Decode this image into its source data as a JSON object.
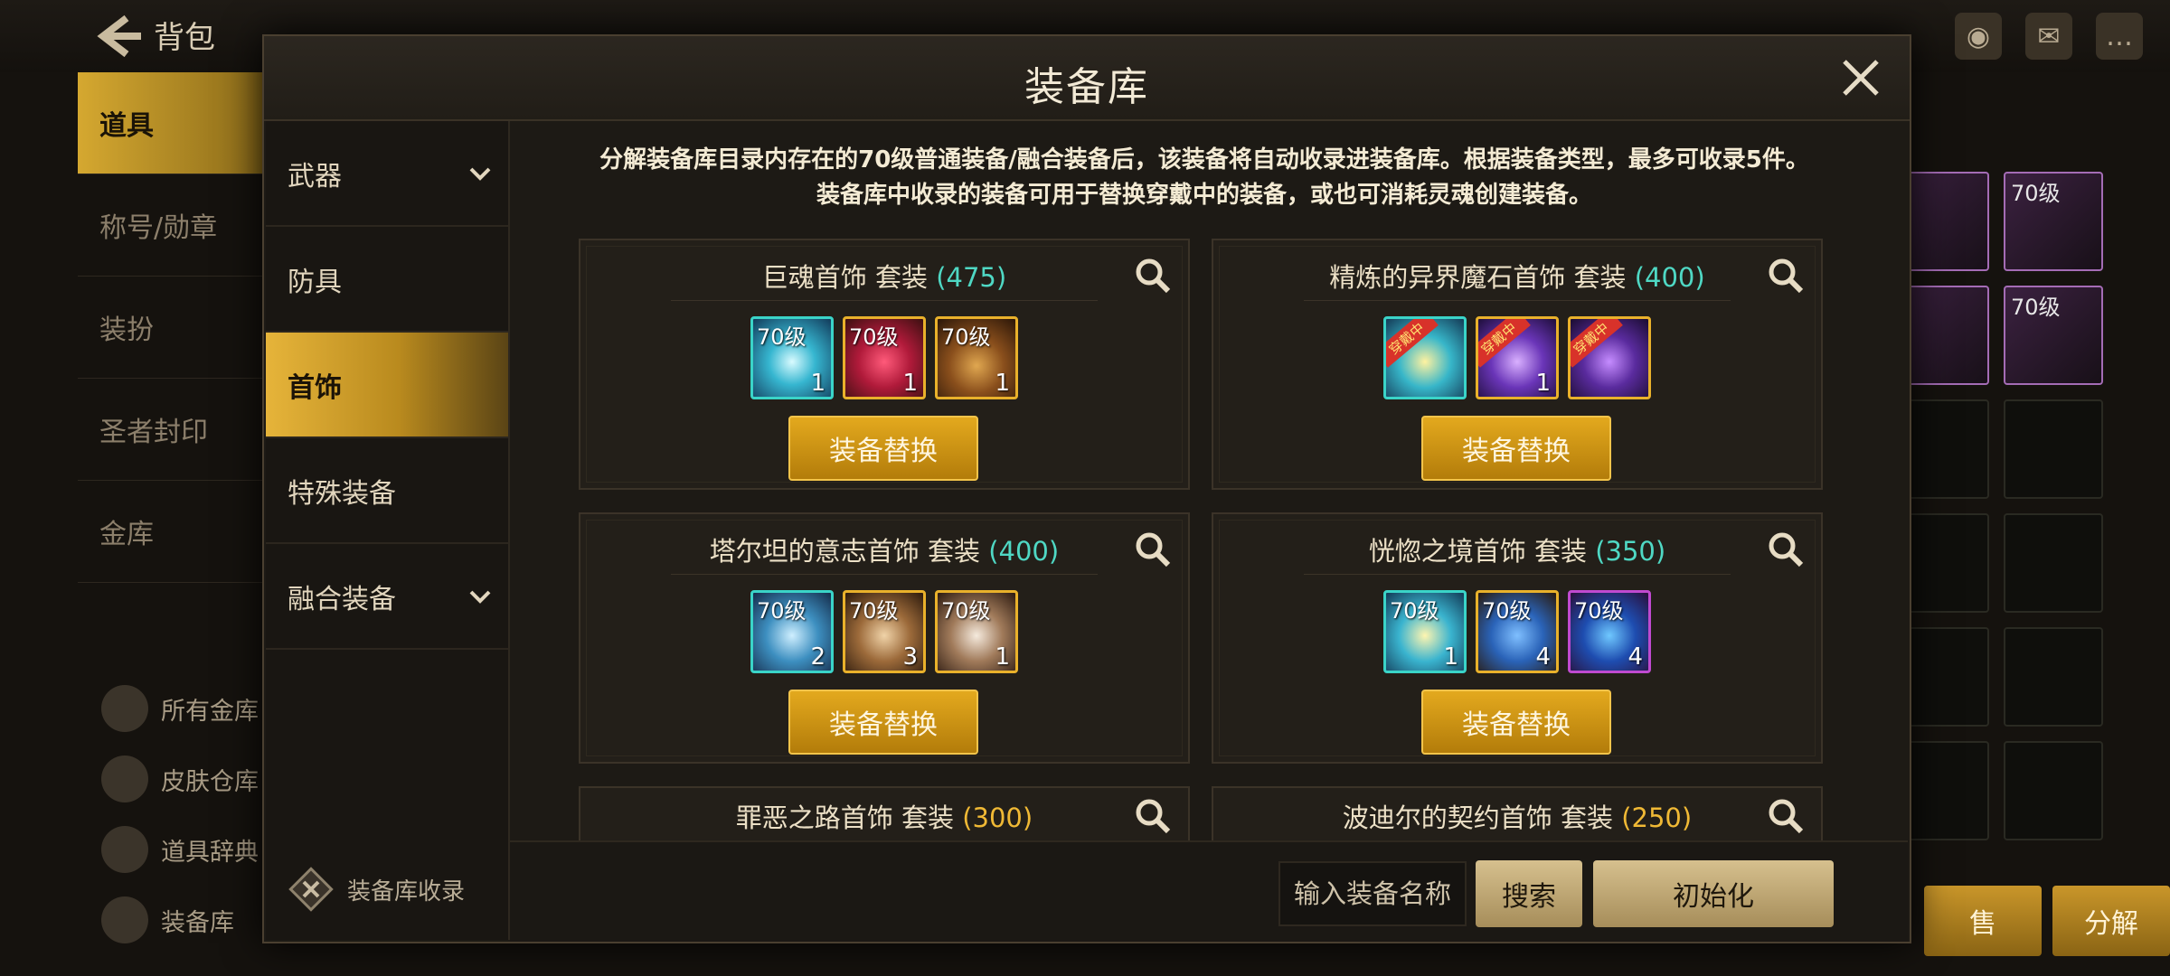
{
  "background": {
    "back_label": "背包",
    "sidebar_items": [
      {
        "label": "道具",
        "active": true
      },
      {
        "label": "称号/勋章",
        "active": false
      },
      {
        "label": "装扮",
        "active": false
      },
      {
        "label": "圣者封印",
        "active": false
      },
      {
        "label": "金库",
        "active": false
      }
    ],
    "links": [
      {
        "label": "所有金库",
        "icon": "vault-icon"
      },
      {
        "label": "皮肤仓库",
        "icon": "brush-icon"
      },
      {
        "label": "道具辞典",
        "icon": "book-icon"
      },
      {
        "label": "装备库",
        "icon": "armor-icon"
      }
    ],
    "grid_levels": [
      "70级",
      "70级"
    ],
    "right_buttons": [
      "售",
      "分解"
    ]
  },
  "modal": {
    "title": "装备库",
    "categories": [
      {
        "label": "武器",
        "expandable": true,
        "active": false
      },
      {
        "label": "防具",
        "expandable": false,
        "active": false
      },
      {
        "label": "首饰",
        "expandable": false,
        "active": true
      },
      {
        "label": "特殊装备",
        "expandable": false,
        "active": false
      },
      {
        "label": "融合装备",
        "expandable": true,
        "active": false
      }
    ],
    "collection_label": "装备库收录",
    "description_line1": "分解装备库目录内存在的70级普通装备/融合装备后，该装备将自动收录进装备库。根据装备类型，最多可收录5件。",
    "description_line2": "装备库中收录的装备可用于替换穿戴中的装备，或也可消耗灵魂创建装备。",
    "sets": [
      {
        "name": "巨魂首饰  套装 ",
        "points": "(475)",
        "button": "装备替换",
        "items": [
          {
            "lv": "70级",
            "cnt": "1"
          },
          {
            "lv": "70级",
            "cnt": "1"
          },
          {
            "lv": "70级",
            "cnt": "1"
          }
        ]
      },
      {
        "name": "精炼的异界魔石首饰  套装 ",
        "points": "(400)",
        "button": "装备替换",
        "items": [
          {
            "lv": "",
            "cnt": "",
            "ribbon": "穿戴中"
          },
          {
            "lv": "",
            "cnt": "1",
            "ribbon": "穿戴中"
          },
          {
            "lv": "",
            "cnt": "",
            "ribbon": "穿戴中"
          }
        ]
      },
      {
        "name": "塔尔坦的意志首饰  套装 ",
        "points": "(400)",
        "button": "装备替换",
        "items": [
          {
            "lv": "70级",
            "cnt": "2"
          },
          {
            "lv": "70级",
            "cnt": "3"
          },
          {
            "lv": "70级",
            "cnt": "1"
          }
        ]
      },
      {
        "name": "恍惚之境首饰  套装 ",
        "points": "(350)",
        "button": "装备替换",
        "items": [
          {
            "lv": "70级",
            "cnt": "1"
          },
          {
            "lv": "70级",
            "cnt": "4"
          },
          {
            "lv": "70级",
            "cnt": "4"
          }
        ]
      },
      {
        "name": "罪恶之路首饰  套装 ",
        "points": "(300)"
      },
      {
        "name": "波迪尔的契约首饰  套装 ",
        "points": "(250)"
      }
    ],
    "search_placeholder": "输入装备名称",
    "search_button": "搜索",
    "reset_button": "初始化"
  }
}
